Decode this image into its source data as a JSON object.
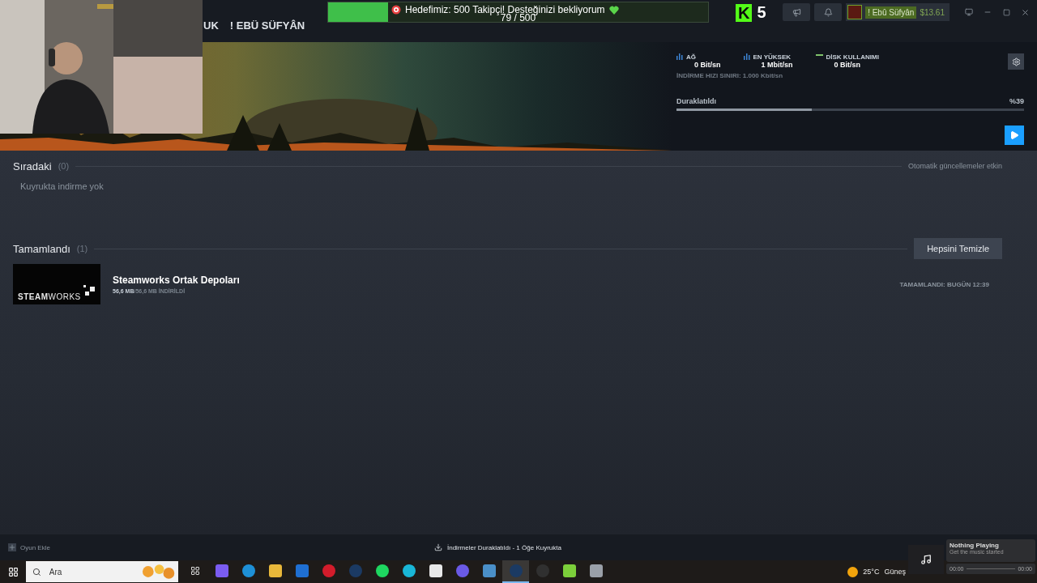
{
  "stream_overlay": {
    "goal": "Hedefimiz: 500 Takipçi! Desteğinizi bekliyorum",
    "count": "79 / 500",
    "level": 0.158
  },
  "channel_badge": {
    "letter": "K",
    "number": "5"
  },
  "header": {
    "nav": [
      {
        "label": "UK",
        "selected": false
      },
      {
        "label": "! EBÜ SÜFYÂN",
        "selected": false
      }
    ],
    "user": "! Ebû Süfyân",
    "wallet": "$13.61"
  },
  "stats": [
    {
      "kind": "bars",
      "label": "AĞ",
      "value": "0 Bit/sn"
    },
    {
      "kind": "bars",
      "label": "EN YÜKSEK",
      "value": "1 Mbit/sn"
    },
    {
      "kind": "line",
      "label": "DİSK KULLANIMI",
      "value": "0 Bit/sn"
    }
  ],
  "speed_limit": "İNDİRME HIZI SINIRI: 1.000 Kbit/sn",
  "download": {
    "status": "Duraklatıldı",
    "percent": "%39",
    "level": 0.39
  },
  "queue": {
    "title": "Sıradaki",
    "count": "(0)",
    "empty": "Kuyrukta indirme yok",
    "note": "Otomatik güncellemeler etkin"
  },
  "completed": {
    "title": "Tamamlandı",
    "count": "(1)",
    "button": "Hepsini Temizle",
    "items": [
      {
        "name": "Steamworks Ortak Depoları",
        "logo_a": "STEAM",
        "logo_b": "WORKS",
        "size": "56,6 MB",
        "total": "/56,6 MB İNDİRİLDİ",
        "finished": "TAMAMLANDI: BUGÜN 12:39"
      }
    ]
  },
  "footer": {
    "add_game": "Oyun Ekle",
    "status": "İndirmeler Duraklatıldı - 1 Öğe Kuyrukta"
  },
  "taskbar": {
    "search": {
      "placeholder": "Ara"
    },
    "apps": [
      {
        "kind": "square",
        "color": "#7b5cf0",
        "selected": false
      },
      {
        "kind": "circle",
        "color": "#1e90d6",
        "selected": false
      },
      {
        "kind": "square",
        "color": "#e9b83a",
        "selected": false
      },
      {
        "kind": "square",
        "color": "#1f6fd1",
        "selected": false
      },
      {
        "kind": "circle",
        "color": "#d31c2b",
        "selected": false
      },
      {
        "kind": "circle",
        "color": "#1b3a63",
        "selected": false
      },
      {
        "kind": "circle",
        "color": "#1ed760",
        "selected": false
      },
      {
        "kind": "circle",
        "color": "#19b6d6",
        "selected": false
      },
      {
        "kind": "square",
        "color": "#e8e8e8",
        "selected": false
      },
      {
        "kind": "circle",
        "color": "#6a5ae6",
        "selected": false
      },
      {
        "kind": "square",
        "color": "#4a8fc7",
        "selected": false
      },
      {
        "kind": "circle",
        "color": "#1b3a63",
        "selected": true
      },
      {
        "kind": "circle",
        "color": "#303030",
        "selected": false
      },
      {
        "kind": "square",
        "color": "#7ccf3a",
        "selected": false
      },
      {
        "kind": "square",
        "color": "#9aa0a8",
        "selected": false
      }
    ],
    "weather": {
      "temp": "25°C",
      "text": "Güneş"
    }
  },
  "music": {
    "title": "Nothing Playing",
    "subtitle": "Get the music started",
    "start": "00:00",
    "end": "00:00"
  }
}
